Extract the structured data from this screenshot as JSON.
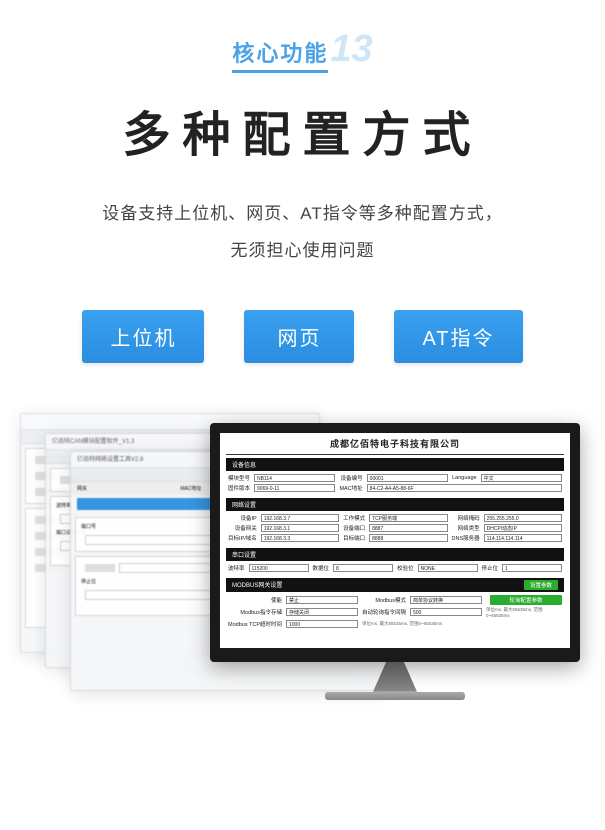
{
  "header": {
    "label": "核心功能",
    "number": "13"
  },
  "title": "多种配置方式",
  "subtitle_line1": "设备支持上位机、网页、AT指令等多种配置方式，",
  "subtitle_line2": "无须担心使用问题",
  "buttons": {
    "b1": "上位机",
    "b2": "网页",
    "b3": "AT指令"
  },
  "bgwin": {
    "app_title1": "亿佰特网络设置工具V2.8",
    "app_title2": "亿佰特CAN模块配置软件_V1.3",
    "toolbar_stop": "停止位",
    "toolbar_port": "端口号",
    "col_gateway": "网关",
    "col_mac": "MAC地址",
    "col_module": "模块名称",
    "sidebar1": "波特率",
    "sidebar2": "端口设置设置"
  },
  "monitor": {
    "company": "成都亿佰特电子科技有限公司",
    "sec_device": "设备信息",
    "sec_network": "网络设置",
    "sec_serial": "串口设置",
    "sec_modbus": "MODBUS网关设置",
    "btn_setparam": "设置参数",
    "btn_enable": "轮询配置参数",
    "dev": {
      "model_l": "模块型号",
      "model_v": "NB114",
      "fw_l": "固件版本",
      "fw_v": "9069-0-11",
      "sn_l": "设备编号",
      "sn_v": "00001",
      "lang_l": "Language",
      "lang_v": "中文",
      "mac_l": "MAC地址",
      "mac_v": "84-C2-A4-A5-88-6F"
    },
    "net": {
      "ip_l": "设备IP",
      "ip_v": "192.168.3.7",
      "mode_l": "工作模式",
      "mode_v": "TCP服务端",
      "mask_l": "网络掩码",
      "mask_v": "255.255.255.0",
      "gw_l": "设备网关",
      "gw_v": "192.168.3.1",
      "port_l": "设备端口",
      "port_v": "8887",
      "type_l": "网络类型",
      "type_v": "DHCP/动态IP",
      "tip_l": "目标IP/域名",
      "tip_v": "192.168.3.3",
      "tport_l": "目标端口",
      "tport_v": "8888",
      "dns_l": "DNS服务器",
      "dns_v": "114.114.114.114"
    },
    "serial": {
      "baud_l": "波特率",
      "baud_v": "115200",
      "data_l": "数据位",
      "data_v": "8",
      "parity_l": "校验位",
      "parity_v": "NONE",
      "stop_l": "停止位",
      "stop_v": "1"
    },
    "modbus": {
      "en_l": "使能",
      "en_v": "禁止",
      "mode_l": "Modbus模式",
      "mode_v": "简单协议转换",
      "cmd_l": "Modbus指令存储",
      "cmd_v": "存储关闭",
      "to_l": "Modbus TCP超时时间",
      "to_v": "1000",
      "auto_l": "自动轮询指令间隔",
      "auto_v": "500",
      "hint": "单位ms, 最大65535ms, 范围0~65535ms"
    }
  }
}
